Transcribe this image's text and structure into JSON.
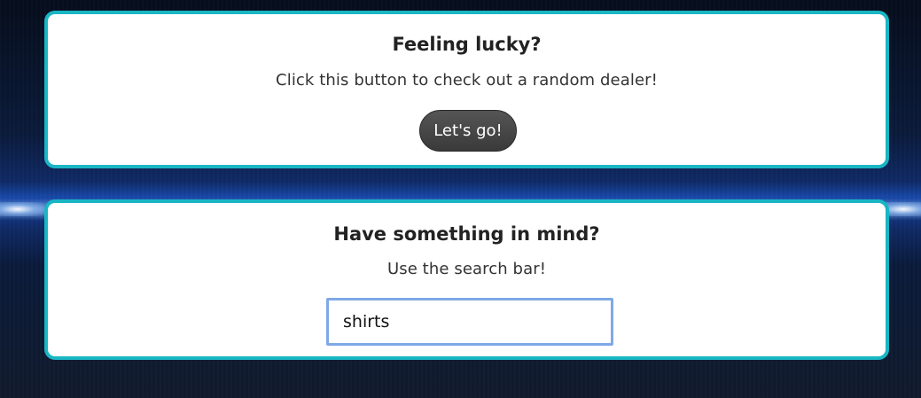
{
  "lucky": {
    "title": "Feeling lucky?",
    "description": "Click this button to check out a random dealer!",
    "button_label": "Let's go!"
  },
  "search": {
    "title": "Have something in mind?",
    "description": "Use the search bar!",
    "value": "shirts",
    "placeholder": ""
  },
  "colors": {
    "card_border": "#19b6c4",
    "button_bg": "#444444",
    "input_focus_border": "#7fa8e8"
  }
}
